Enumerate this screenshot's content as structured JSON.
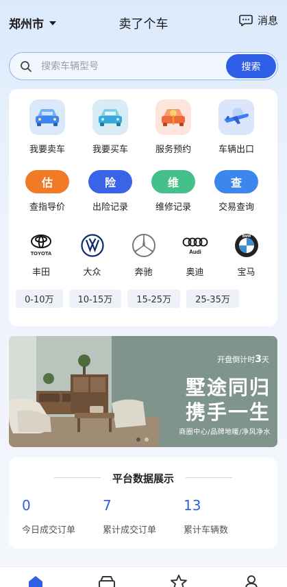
{
  "header": {
    "city": "郑州市",
    "title": "卖了个车",
    "message_label": "消息"
  },
  "search": {
    "placeholder": "搜索车辆型号",
    "button": "搜索"
  },
  "services": [
    {
      "label": "我要卖车",
      "icon": "sell-car-icon"
    },
    {
      "label": "我要买车",
      "icon": "buy-car-icon"
    },
    {
      "label": "服务预约",
      "icon": "service-booking-icon"
    },
    {
      "label": "车辆出口",
      "icon": "car-export-icon"
    }
  ],
  "queries": [
    {
      "badge": "估",
      "label": "查指导价",
      "color": "#f07a25"
    },
    {
      "badge": "险",
      "label": "出险记录",
      "color": "#3a64e8"
    },
    {
      "badge": "维",
      "label": "维修记录",
      "color": "#45c08a"
    },
    {
      "badge": "查",
      "label": "交易查询",
      "color": "#3c86ee"
    }
  ],
  "brands": [
    {
      "label": "丰田",
      "logo_text": "TOYOTA",
      "icon": "toyota-logo-icon"
    },
    {
      "label": "大众",
      "icon": "volkswagen-logo-icon"
    },
    {
      "label": "奔驰",
      "icon": "mercedes-logo-icon"
    },
    {
      "label": "奥迪",
      "logo_text": "Audi",
      "icon": "audi-logo-icon"
    },
    {
      "label": "宝马",
      "logo_text": "BMW",
      "icon": "bmw-logo-icon"
    }
  ],
  "price_ranges": [
    "0-10万",
    "10-15万",
    "15-25万",
    "25-35万"
  ],
  "banner": {
    "countdown_prefix": "开盘倒计时",
    "countdown_value": "3",
    "countdown_unit": "天",
    "headline_1": "墅途同归",
    "headline_2": "携手一生",
    "footer": "商圈中心/品牌地暖/净风净水",
    "active_slide": 1,
    "slide_count": 2
  },
  "stats": {
    "title": "平台数据展示",
    "items": [
      {
        "value": "0",
        "label": "今日成交订单"
      },
      {
        "value": "7",
        "label": "累计成交订单"
      },
      {
        "value": "13",
        "label": "累计车辆数"
      }
    ]
  },
  "tabbar": {
    "tabs": [
      {
        "icon": "home-icon",
        "active": true
      },
      {
        "icon": "car-icon",
        "active": false
      },
      {
        "icon": "star-icon",
        "active": false
      },
      {
        "icon": "user-icon",
        "active": false
      }
    ]
  },
  "colors": {
    "primary": "#2f5fe6",
    "brand_blue": "#3a64e8"
  }
}
